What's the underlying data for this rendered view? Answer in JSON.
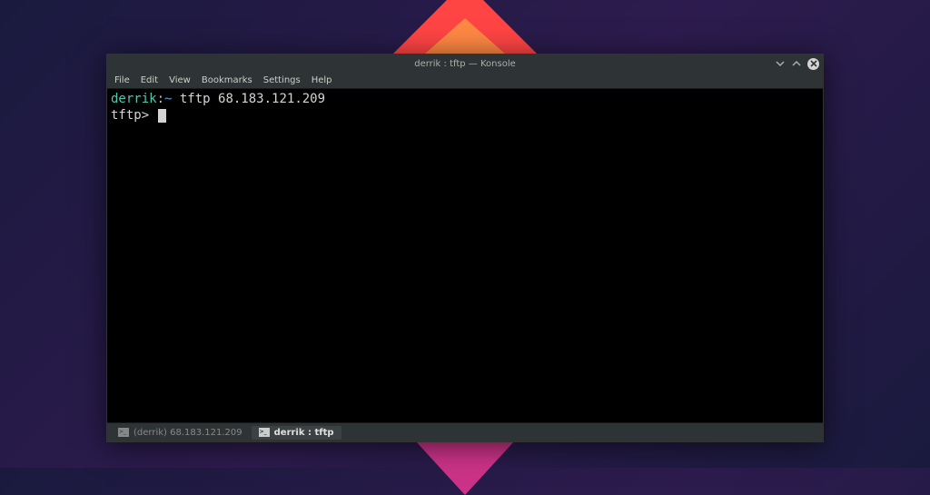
{
  "wallpaper": {
    "gradient": "purple-dark"
  },
  "window": {
    "title": "derrik : tftp — Konsole",
    "controls": {
      "minimize": "⌄",
      "maximize": "⌃",
      "close": "✕"
    }
  },
  "menubar": {
    "items": [
      "File",
      "Edit",
      "View",
      "Bookmarks",
      "Settings",
      "Help"
    ]
  },
  "terminal": {
    "line1": {
      "user": "derrik",
      "separator": ":",
      "path": "~",
      "command": " tftp 68.183.121.209"
    },
    "line2": {
      "prompt": "tftp> "
    }
  },
  "tabs": [
    {
      "label": "(derrik) 68.183.121.209",
      "active": false
    },
    {
      "label": "derrik : tftp",
      "active": true
    }
  ]
}
